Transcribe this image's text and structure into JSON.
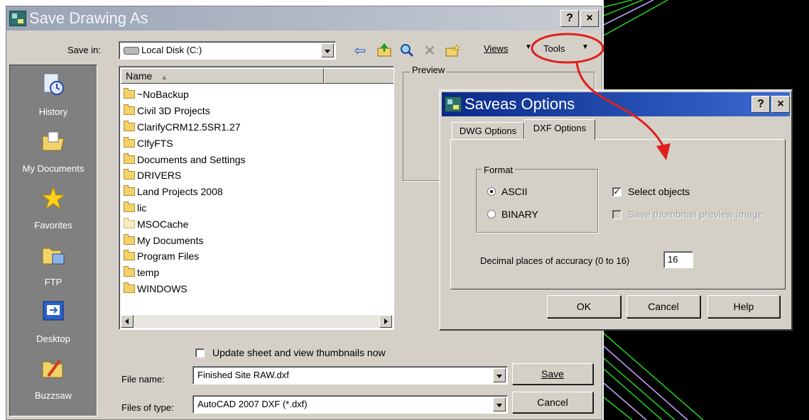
{
  "save_dialog": {
    "title": "Save Drawing As",
    "help_button": "?",
    "close_button": "×",
    "save_in_label": "Save in:",
    "save_in_value": "Local Disk (C:)",
    "views_label": "Views",
    "tools_label": "Tools",
    "places": [
      "History",
      "My Documents",
      "Favorites",
      "FTP",
      "Desktop",
      "Buzzsaw"
    ],
    "name_column": "Name",
    "files": [
      "~NoBackup",
      "Civil 3D Projects",
      "ClarifyCRM12.5SR1.27",
      "ClfyFTS",
      "Documents and Settings",
      "DRIVERS",
      "Land Projects 2008",
      "lic",
      "MSOCache",
      "My Documents",
      "Program Files",
      "temp",
      "WINDOWS"
    ],
    "preview_label": "Preview",
    "update_thumbnails_label": "Update sheet and view thumbnails now",
    "update_thumbnails_checked": false,
    "file_name_label": "File name:",
    "file_name_value": "Finished Site RAW.dxf",
    "file_type_label": "Files of type:",
    "file_type_value": "AutoCAD 2007 DXF (*.dxf)",
    "save_button": "Save",
    "cancel_button": "Cancel"
  },
  "options_dialog": {
    "title": "Saveas Options",
    "help_button": "?",
    "close_button": "×",
    "tabs": [
      "DWG Options",
      "DXF Options"
    ],
    "active_tab": "DXF Options",
    "format_label": "Format",
    "format_ascii": "ASCII",
    "format_binary": "BINARY",
    "selected_format": "ASCII",
    "select_objects_label": "Select objects",
    "select_objects_checked": true,
    "thumbnail_label": "Save thumbnail preview image",
    "thumbnail_enabled": false,
    "decimal_label": "Decimal places of accuracy (0 to 16)",
    "decimal_value": "16",
    "ok_button": "OK",
    "cancel_button": "Cancel",
    "help_button_label": "Help"
  },
  "icons": {
    "back": "back-arrow-icon",
    "up_folder": "up-folder-icon",
    "search_web": "search-web-icon",
    "delete": "delete-icon",
    "new_folder": "new-folder-icon",
    "check_glyph": "✓"
  },
  "colors": {
    "annotation": "#e0201c",
    "dialog_face": "#d4d0c8",
    "options_title": "#0a2a8a",
    "cad_background": "#000000"
  }
}
